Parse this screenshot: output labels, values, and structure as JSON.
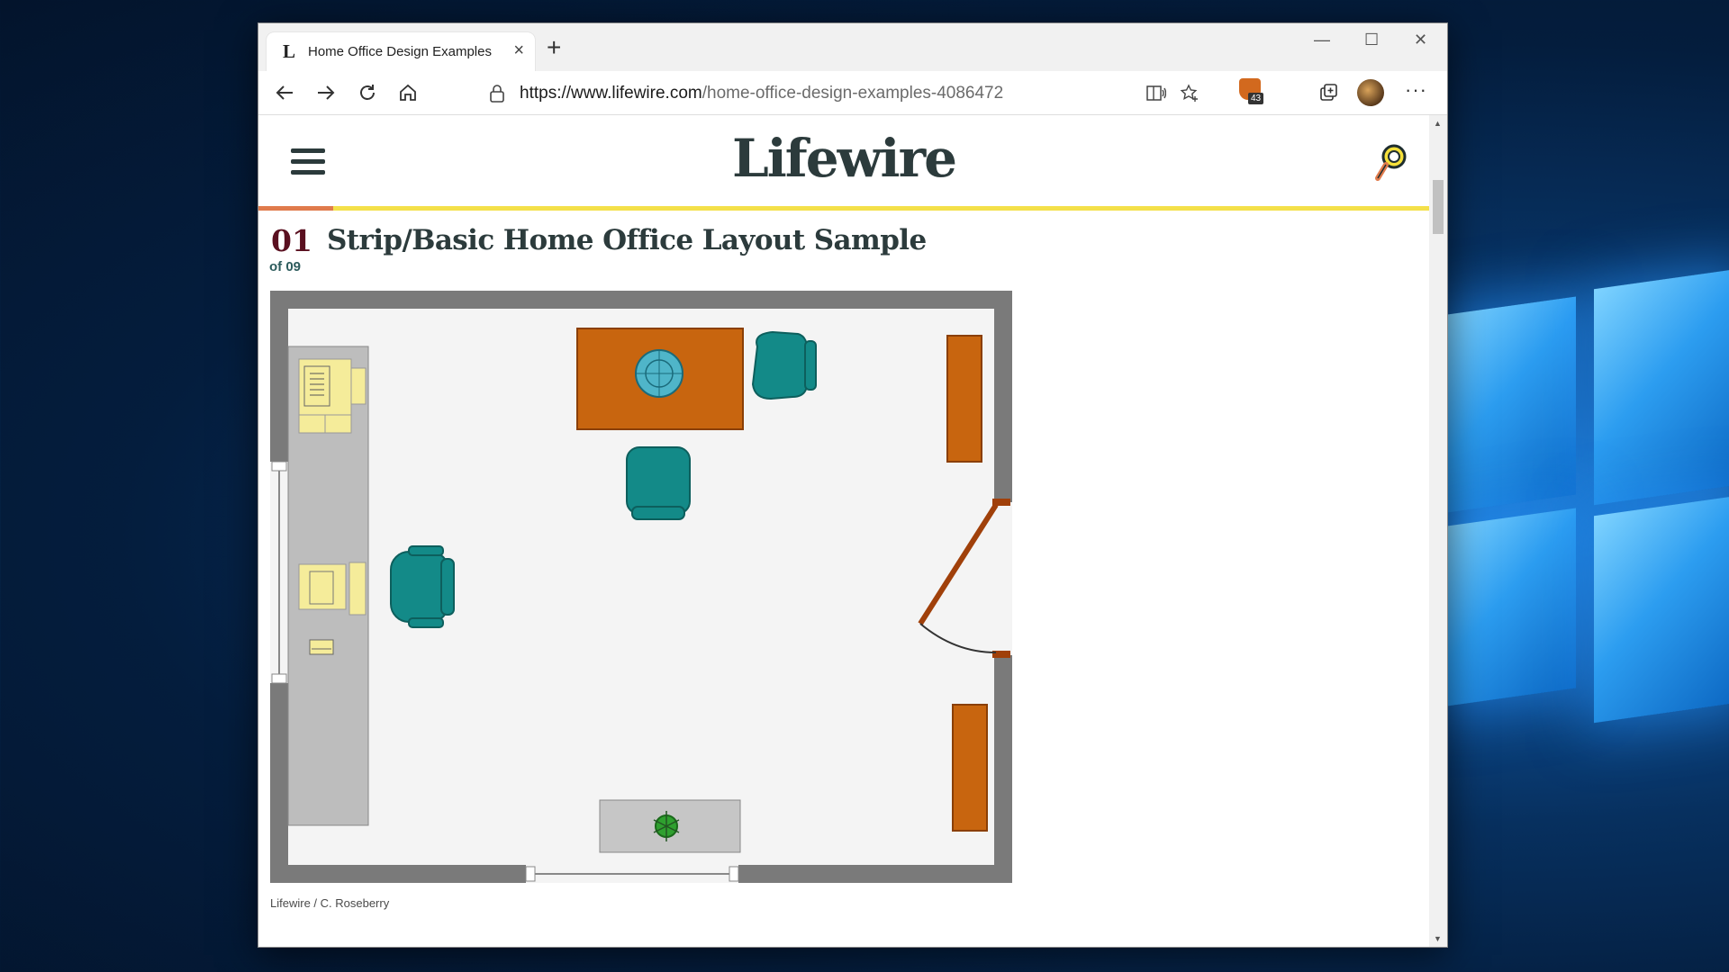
{
  "browser": {
    "tab": {
      "favicon": "L",
      "title": "Home Office Design Examples",
      "close": "×"
    },
    "new_tab": "+",
    "window_controls": {
      "minimize": "—",
      "maximize": "☐",
      "close": "✕"
    },
    "url_host": "https://www.lifewire.com",
    "url_path": "/home-office-design-examples-4086472",
    "extension_badge_count": "43",
    "more_label": "···"
  },
  "page": {
    "logo": "Lifewire",
    "reading_progress": 0.064,
    "step_number": "01",
    "step_of": "of 09",
    "title": "Strip/Basic Home Office Layout Sample",
    "image_caption": "Lifewire / C. Roseberry"
  },
  "colors": {
    "brand_text": "#2c3b3c",
    "progress_fill": "#e07b4c",
    "progress_track": "#f4e04a",
    "step_number": "#5a1020",
    "furniture_wood": "#c8650f",
    "furniture_chair": "#138a88",
    "furniture_yellow": "#f5ec9a"
  }
}
